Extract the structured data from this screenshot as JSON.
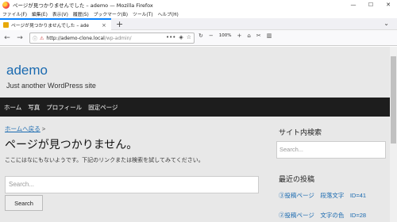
{
  "window": {
    "title": "ページが見つかりませんでした – ademo — Mozilla Firefox",
    "controls": [
      "—",
      "☐",
      "✕"
    ]
  },
  "menu": [
    "ファイル(F)",
    "編集(E)",
    "表示(V)",
    "履歴(S)",
    "ブックマーク(B)",
    "ツール(T)",
    "ヘルプ(H)"
  ],
  "tab": {
    "label": "ページが見つかりませんでした – ade",
    "close": "×"
  },
  "navbar": {
    "url_host": "ademo-clone.local",
    "url_path": "/wp-admin/",
    "zoom": "100%"
  },
  "site": {
    "title": "ademo",
    "tagline": "Just another WordPress site",
    "nav": [
      "ホーム",
      "写真",
      "プロフィール",
      "固定ページ"
    ]
  },
  "content": {
    "breadcrumb_link": "ホームへ戻る",
    "breadcrumb_sep": " >",
    "heading": "ページが見つかりません。",
    "message": "ここにはなにもないようです。下記のリンクまたは検索を試してみてください。",
    "search_placeholder": "Search...",
    "search_button": "Search"
  },
  "sidebar": {
    "search_heading": "サイト内検索",
    "search_placeholder": "Search...",
    "recent_heading": "最近の投稿",
    "recent_posts": [
      "③投稿ページ　段落文字　ID=41",
      "②投稿ページ　文字の色　ID=28"
    ]
  }
}
